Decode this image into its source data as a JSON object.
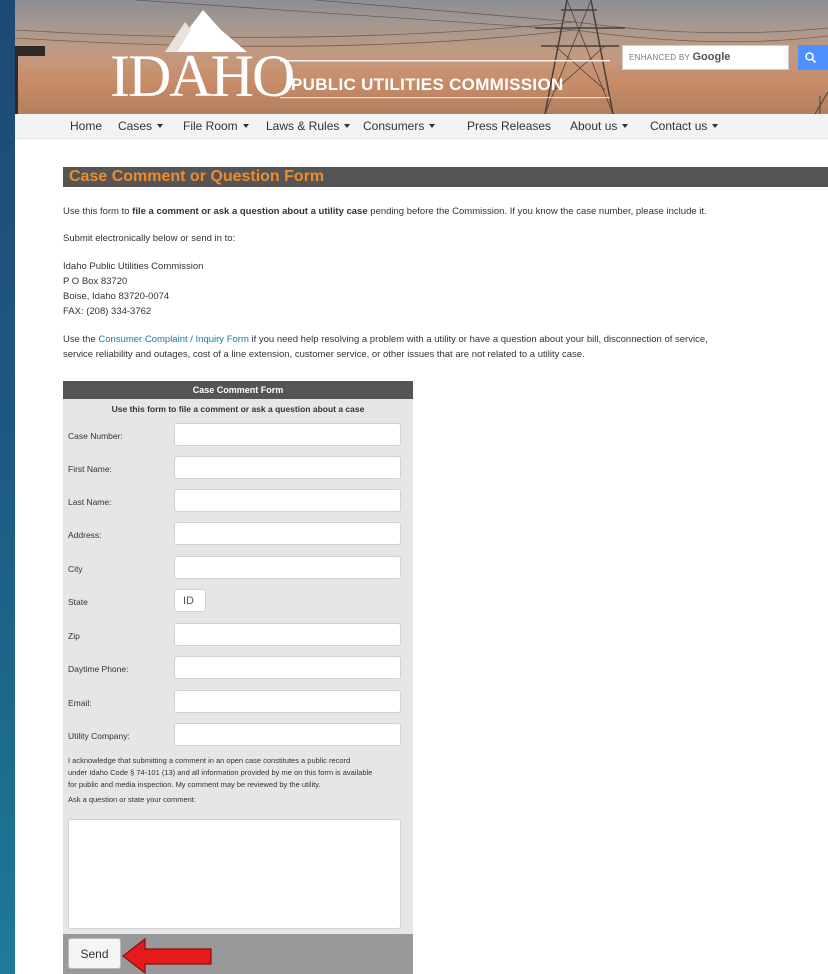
{
  "header": {
    "logo_text": "IDAHO",
    "commission_name": "PUBLIC UTILITIES COMMISSION",
    "search": {
      "enhanced_by": "ENHANCED BY",
      "brand": "Google",
      "placeholder": ""
    }
  },
  "nav": {
    "items": [
      {
        "label": "Home",
        "dropdown": false
      },
      {
        "label": "Cases",
        "dropdown": true
      },
      {
        "label": "File Room",
        "dropdown": true
      },
      {
        "label": "Laws & Rules",
        "dropdown": true
      },
      {
        "label": "Consumers",
        "dropdown": true
      },
      {
        "label": "Press Releases",
        "dropdown": false
      },
      {
        "label": "About us",
        "dropdown": true
      },
      {
        "label": "Contact us",
        "dropdown": true
      }
    ]
  },
  "content": {
    "title": "Case Comment or Question Form",
    "intro_pre": "Use this form to ",
    "intro_bold": "file a comment or ask a question about a utility case",
    "intro_post": " pending before the Commission. If you know the case number, please include it.",
    "submit_note": "Submit electronically below or send in to:",
    "address": {
      "line1": "Idaho Public Utilities Commission",
      "line2": "P O Box 83720",
      "line3": "Boise, Idaho 83720-0074",
      "line4": "FAX: (208) 334-3762"
    },
    "consumer_pre": "Use the ",
    "consumer_link": "Consumer Complaint / Inquiry Form",
    "consumer_post1": " if you need help resolving a problem with a utility or have a question about your bill, disconnection of service,",
    "consumer_post2": "service reliability and outages, cost of a line extension, customer service, or other issues that are not related to a utility case."
  },
  "form": {
    "title": "Case Comment Form",
    "subtitle": "Use this form to file a comment or ask a question about a case",
    "fields": {
      "case_number": {
        "label": "Case Number:",
        "value": ""
      },
      "first_name": {
        "label": "First Name:",
        "value": ""
      },
      "last_name": {
        "label": "Last Name:",
        "value": ""
      },
      "address": {
        "label": "Address:",
        "value": ""
      },
      "city": {
        "label": "City",
        "value": ""
      },
      "state": {
        "label": "State",
        "value": "ID"
      },
      "zip": {
        "label": "Zip",
        "value": ""
      },
      "phone": {
        "label": "Daytime Phone:",
        "value": ""
      },
      "email": {
        "label": "Email:",
        "value": ""
      },
      "utility": {
        "label": "Utility Company:",
        "value": ""
      }
    },
    "ack_line1": "I acknowledge that submitting a comment in an open case constitutes a public record",
    "ack_line2": "under Idaho Code § 74-101 (13) and all information provided by me on this form is available",
    "ack_line3": "for public and media inspection. My comment may be reviewed by the utility.",
    "comment_label": "Ask a question or state your comment:",
    "comment_value": "",
    "send_label": "Send"
  },
  "colors": {
    "heading_text": "#f08a2b",
    "heading_bg": "#555555",
    "link": "#1a78a8",
    "annotation_arrow": "#e51b1b"
  }
}
